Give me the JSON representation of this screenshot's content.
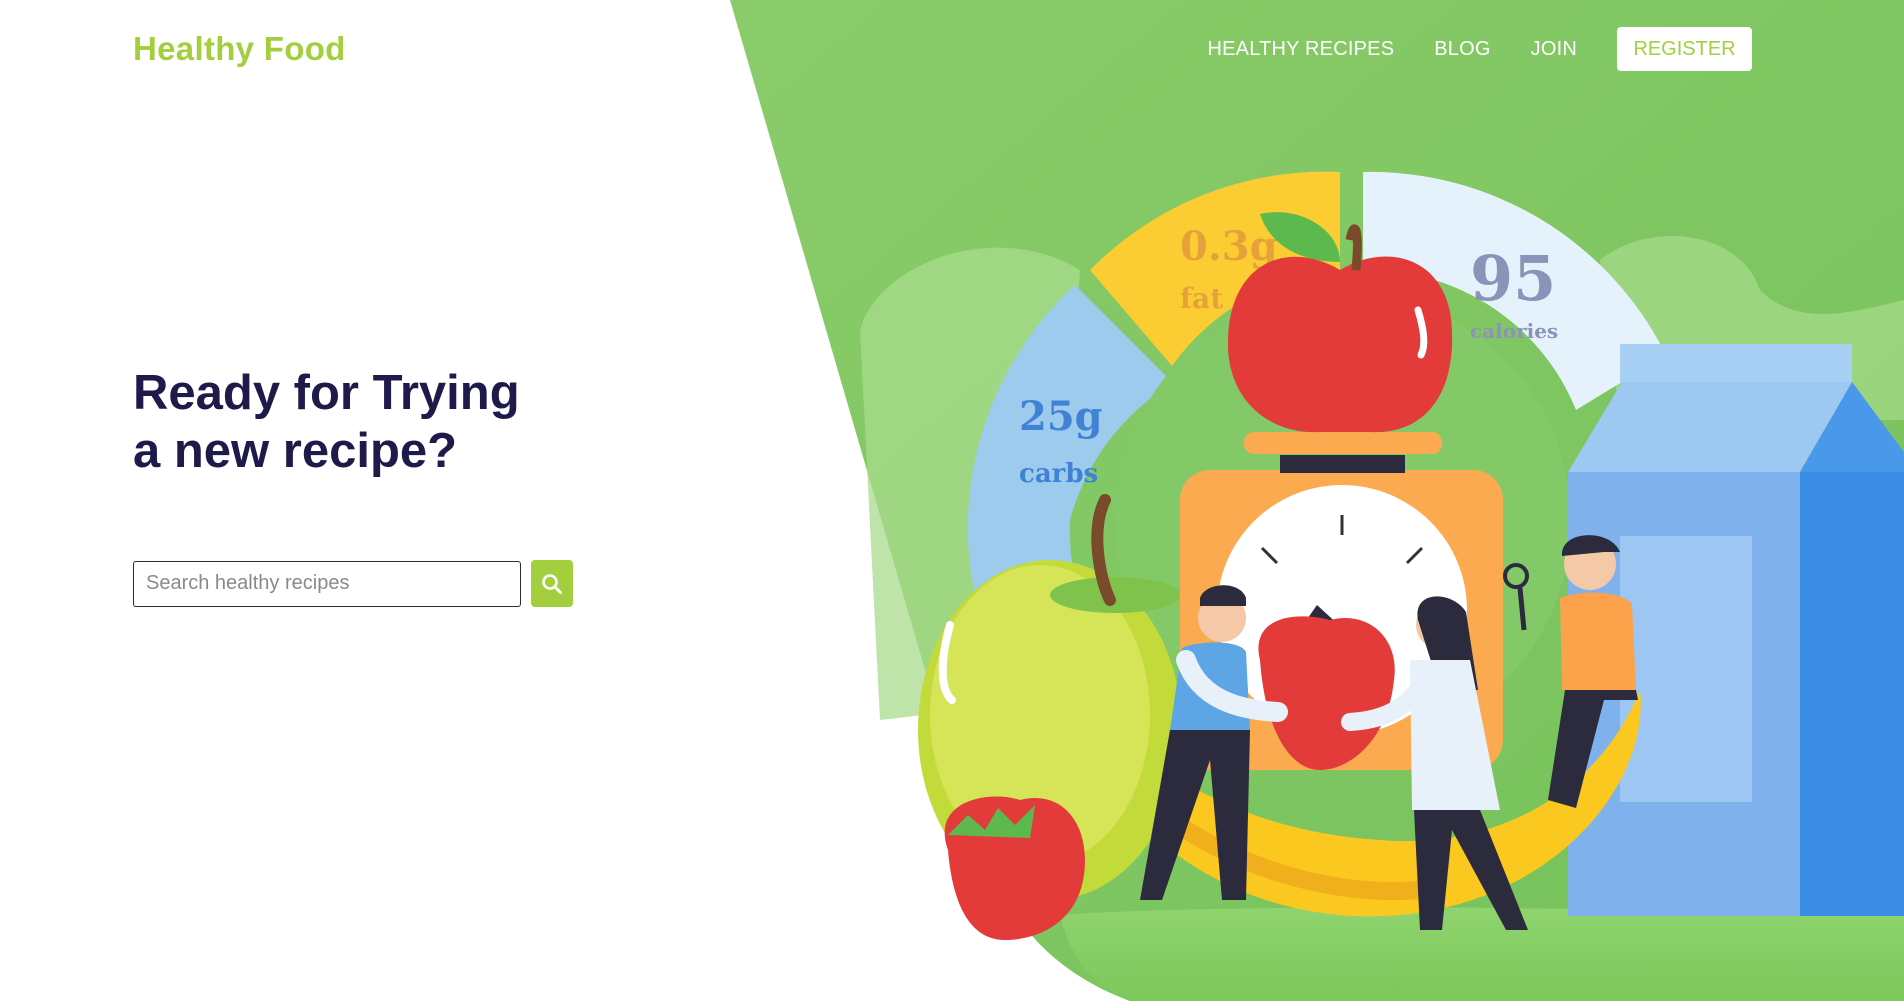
{
  "logo": {
    "text": "Healthy Food"
  },
  "nav": {
    "links": [
      "HEALTHY RECIPES",
      "BLOG",
      "JOIN"
    ],
    "register_label": "REGISTER"
  },
  "hero": {
    "headline": "Ready for Trying a new recipe?"
  },
  "search": {
    "placeholder": "Search healthy recipes",
    "value": ""
  },
  "nutrition": {
    "fat_value": "0.3g",
    "fat_label": "fat",
    "calories_value": "95",
    "calories_label": "calories",
    "carbs_value": "25g",
    "carbs_label": "carbs"
  },
  "colors": {
    "brand": "#a3cf3e",
    "hero_green": "#84c968",
    "heading": "#1e1b4b"
  },
  "icons": {
    "search_button": "search-icon"
  }
}
